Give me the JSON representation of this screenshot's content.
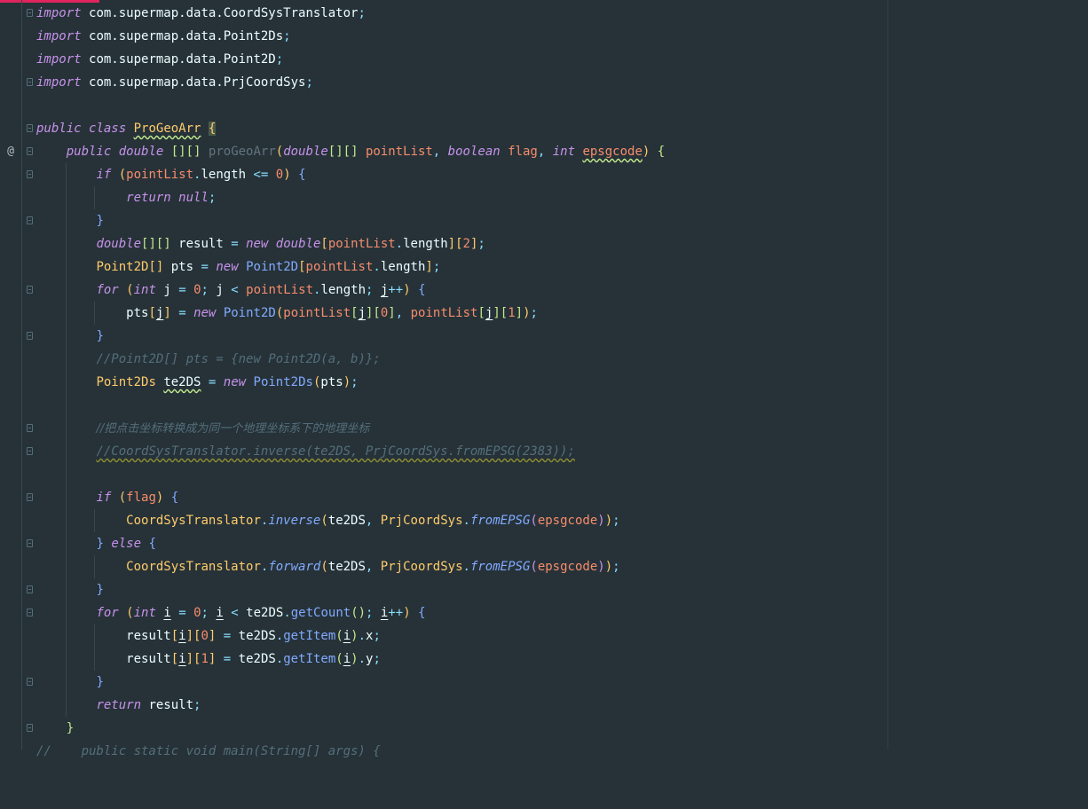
{
  "colors": {
    "background": "#263238",
    "keyword": "#C792EA",
    "type": "#FFCB6B",
    "function": "#82AAFF",
    "parameter": "#F78C6C",
    "comment": "#546E7A",
    "accent": "#E0245E"
  },
  "gutter": {
    "override_marker": "@",
    "override_icon": "override-marker-icon"
  },
  "code": {
    "imports": [
      "com.supermap.data.CoordSysTranslator",
      "com.supermap.data.Point2Ds",
      "com.supermap.data.Point2D",
      "com.supermap.data.PrjCoordSys"
    ],
    "kw_import": "import",
    "kw_public": "public",
    "kw_class": "class",
    "class_name": "ProGeoArr",
    "kw_double": "double",
    "kw_boolean": "boolean",
    "kw_int": "int",
    "kw_if": "if",
    "kw_return": "return",
    "kw_null": "null",
    "kw_new": "new",
    "kw_for": "for",
    "kw_else": "else",
    "method_name": "proGeoArr",
    "param_pointList": "pointList",
    "param_flag": "flag",
    "param_epsgcode": "epsgcode",
    "var_result": "result",
    "var_pts": "pts",
    "var_te2DS": "te2DS",
    "var_j": "j",
    "var_i": "i",
    "type_Point2D": "Point2D",
    "type_Point2Ds": "Point2Ds",
    "type_CoordSysTranslator": "CoordSysTranslator",
    "type_PrjCoordSys": "PrjCoordSys",
    "field_length": "length",
    "method_inverse": "inverse",
    "method_forward": "forward",
    "method_fromEPSG": "fromEPSG",
    "method_getCount": "getCount",
    "method_getItem": "getItem",
    "field_x": "x",
    "field_y": "y",
    "num_0": "0",
    "num_1": "1",
    "num_2": "2",
    "comment_pts": "//Point2D[] pts = {new Point2D(a, b)};",
    "comment_chinese": "//把点击坐标转换成为同一个地理坐标系下的地理坐标",
    "comment_inverse": "//CoordSysTranslator.inverse(te2DS, PrjCoordSys.fromEPSG(2383));",
    "comment_main": "//    public static void main(String[] args) {"
  }
}
